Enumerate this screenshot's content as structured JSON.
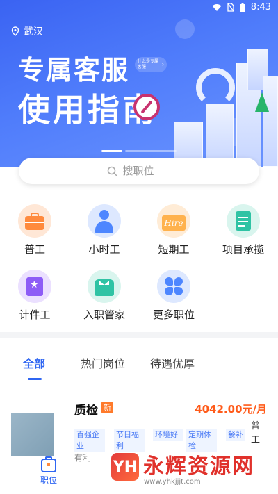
{
  "status_bar": {
    "time": "8:43"
  },
  "banner": {
    "location": "武汉",
    "title_line1": "专属客服",
    "title_line2": "使用指南",
    "tagline": "什么是专属客服",
    "indicator_active_index": 0
  },
  "search": {
    "placeholder": "搜职位"
  },
  "categories": [
    {
      "label": "普工",
      "icon": "toolbox-icon",
      "color": "#ff8a3d"
    },
    {
      "label": "小时工",
      "icon": "person-icon",
      "color": "#4d86ff"
    },
    {
      "label": "短期工",
      "icon": "hire-sign-icon",
      "color": "#ff9c3d"
    },
    {
      "label": "项目承揽",
      "icon": "clipboard-icon",
      "color": "#2fc3a4"
    },
    {
      "label": "计件工",
      "icon": "star-book-icon",
      "color": "#8d5cf6"
    },
    {
      "label": "入职管家",
      "icon": "butler-icon",
      "color": "#2fc3a4"
    },
    {
      "label": "更多职位",
      "icon": "grid-icon",
      "color": "#4d86ff"
    }
  ],
  "tabs": [
    {
      "label": "全部",
      "active": true
    },
    {
      "label": "热门岗位",
      "active": false
    },
    {
      "label": "待遇优厚",
      "active": false
    }
  ],
  "job": {
    "title": "质检",
    "badge": "新",
    "salary": "4042.00元/月",
    "tags": [
      "百强企业",
      "节日福利",
      "环境好",
      "定期体检",
      "餐补"
    ],
    "type": "普工",
    "cut_text": "有利"
  },
  "bottom_nav": {
    "label": "职位"
  },
  "watermark": {
    "text": "永辉资源网",
    "url": "www.yhkjjjt.com"
  }
}
